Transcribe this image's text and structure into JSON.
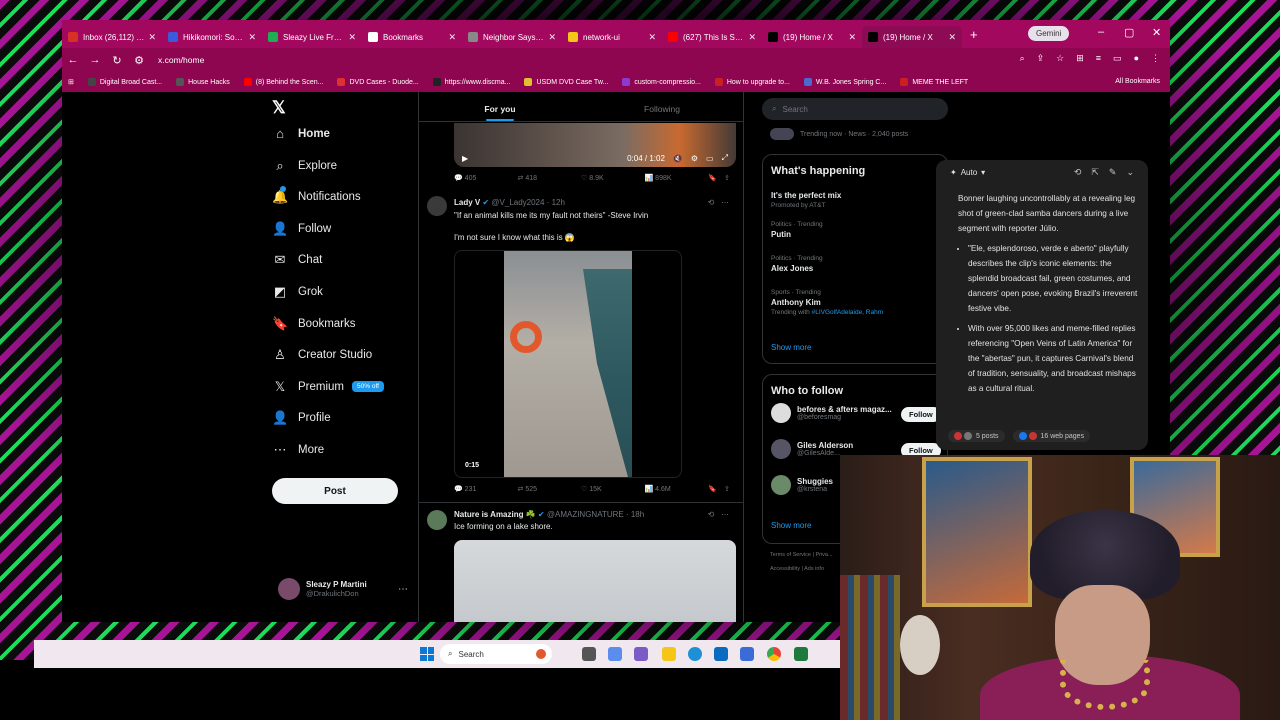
{
  "tabs": [
    {
      "title": "Inbox (26,112) - h",
      "icon_color": "#d93025",
      "active": false
    },
    {
      "title": "Hikikomori: Some",
      "icon_color": "#3b5bdb",
      "active": false
    },
    {
      "title": "Sleazy Live From",
      "icon_color": "#1fae52",
      "active": false
    },
    {
      "title": "Bookmarks",
      "icon_color": "#ffffff",
      "active": false
    },
    {
      "title": "Neighbor Says Ch",
      "icon_color": "#888888",
      "active": false
    },
    {
      "title": "network-ui",
      "icon_color": "#f5c518",
      "active": false
    },
    {
      "title": "(627) This Is Serio",
      "icon_color": "#ff0000",
      "active": false
    },
    {
      "title": "(19) Home / X",
      "icon_color": "#000000",
      "active": false
    },
    {
      "title": "(19) Home / X",
      "icon_color": "#000000",
      "active": true
    }
  ],
  "gemini_button": "Gemini",
  "address": "x.com/home",
  "bookmarks": [
    {
      "label": "Digital Broad Cast...",
      "color": "#444"
    },
    {
      "label": "House Hacks",
      "color": "#555"
    },
    {
      "label": "(8) Behind the Scen...",
      "color": "#ff0000"
    },
    {
      "label": "DVD Cases - Duode...",
      "color": "#e03030"
    },
    {
      "label": "https://www.discma...",
      "color": "#222"
    },
    {
      "label": "USDM DVD Case Tw...",
      "color": "#e0c030"
    },
    {
      "label": "custom-compressio...",
      "color": "#8a3ad0"
    },
    {
      "label": "How to upgrade to...",
      "color": "#cc2020"
    },
    {
      "label": "W.B. Jones Spring C...",
      "color": "#4a6ad0"
    },
    {
      "label": "MEME THE LEFT",
      "color": "#cc2020"
    }
  ],
  "all_bookmarks": "All Bookmarks",
  "nav": {
    "items": [
      {
        "label": "Home",
        "icon": "⌂",
        "bold": true
      },
      {
        "label": "Explore",
        "icon": "⌕"
      },
      {
        "label": "Notifications",
        "icon": "🔔"
      },
      {
        "label": "Follow",
        "icon": "👤"
      },
      {
        "label": "Chat",
        "icon": "✉"
      },
      {
        "label": "Grok",
        "icon": "◩"
      },
      {
        "label": "Bookmarks",
        "icon": "🔖"
      },
      {
        "label": "Creator Studio",
        "icon": "♙"
      },
      {
        "label": "Premium",
        "icon": "𝕏"
      },
      {
        "label": "Profile",
        "icon": "👤"
      },
      {
        "label": "More",
        "icon": "⋯"
      }
    ],
    "premium_badge": "50% off",
    "post": "Post",
    "account_name": "Sleazy P Martini",
    "account_handle": "@DrakulichDon"
  },
  "timeline": {
    "tab_for_you": "For you",
    "tab_following": "Following",
    "video1_time": "0:04 / 1:02",
    "video1_actions": [
      "405",
      "418",
      "8.9K",
      "898K"
    ],
    "tweet1": {
      "name": "Lady V",
      "handle": "@V_Lady2024 · 12h",
      "line1": "\"If an animal kills me its my fault not theirs\" -Steve Irvin",
      "line2": "I'm not sure I know what this is 😱",
      "video_time": "0:15",
      "actions": [
        "231",
        "525",
        "15K",
        "4.6M"
      ]
    },
    "tweet2": {
      "name": "Nature is Amazing ☘️",
      "handle": "@AMAZINGNATURE · 18h",
      "text": "Ice forming on a lake shore."
    }
  },
  "right": {
    "search_placeholder": "Search",
    "top_trend_meta": "Trending now · News · 2,040 posts",
    "happening_title": "What's happening",
    "trends": [
      {
        "category": "",
        "name": "It's the perfect mix",
        "extra": "Promoted by AT&T"
      },
      {
        "category": "Politics · Trending",
        "name": "Putin",
        "extra": ""
      },
      {
        "category": "Politics · Trending",
        "name": "Alex Jones",
        "extra": ""
      },
      {
        "category": "Sports · Trending",
        "name": "Anthony Kim",
        "extra_prefix": "Trending with ",
        "extra": "#LIVGolfAdelaide, Rahm"
      }
    ],
    "show_more": "Show more",
    "who_title": "Who to follow",
    "follow": [
      {
        "name": "befores & afters magaz...",
        "handle": "@beforesmag",
        "color": "#ddd"
      },
      {
        "name": "Giles Alderson",
        "handle": "@GilesAlde...",
        "color": "#556"
      },
      {
        "name": "Shuggies",
        "handle": "@krstena",
        "color": "#6a8a6a"
      }
    ],
    "follow_button": "Follow",
    "footer1": "Terms of Service  |  Priva...",
    "footer2": "Accessibility  |  Ads info"
  },
  "gemini": {
    "mode": "Auto",
    "intro": "Bonner laughing uncontrollably at a revealing leg shot of green-clad samba dancers during a live segment with reporter Júlio.",
    "bullets": [
      "\"Ele, esplendoroso, verde e aberto\" playfully describes the clip's iconic elements: the splendid broadcast fail, green costumes, and dancers' open pose, evoking Brazil's irreverent festive vibe.",
      "With over 95,000 likes and meme-filled replies referencing \"Open Veins of Latin America\" for the \"abertas\" pun, it captures Carnival's blend of tradition, sensuality, and broadcast mishaps as a cultural ritual."
    ],
    "sources_posts": "5 posts",
    "sources_web": "16 web pages"
  },
  "taskbar": {
    "search": "Search"
  }
}
